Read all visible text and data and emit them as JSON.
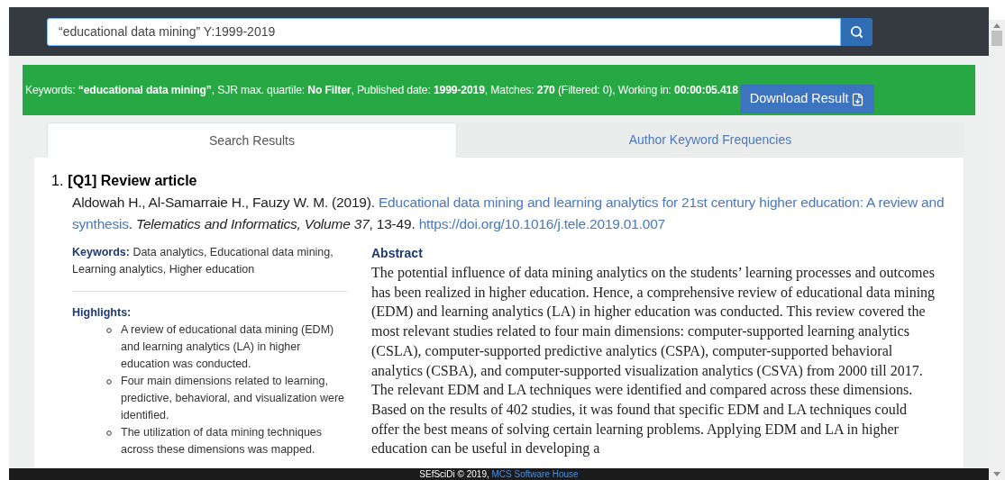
{
  "search": {
    "value": "“educational data mining” Y:1999-2019"
  },
  "banner": {
    "summary": "Keywords: **“educational data mining”**, SJR max. quartile: **No Filter**, Published date: **1999-2019**, Matches: **270** (Filtered: 0), Working in: **00:00:05.418**",
    "download_label": "Download Result"
  },
  "tabs": [
    {
      "label": "Search Results",
      "selected": true
    },
    {
      "label": "Author Keyword Frequencies",
      "selected": false
    }
  ],
  "results": [
    {
      "number": "1.",
      "title": "[Q1] Review article",
      "authors": "Aldowah H., Al-Samarraie H., Fauzy W. M. (2019). ",
      "article_title": "Educational data mining and learning analytics for 21st century higher education: A review and synthesis",
      "source": ". *Telematics and Informatics, Volume 37*, 13-49. ",
      "doi": "https://doi.org/10.1016/j.tele.2019.01.007",
      "keywords_label": "Keywords:",
      "keywords": "Data analytics, Educational data mining, Learning analytics, Higher education",
      "highlights_label": "Highlights:",
      "highlights": [
        "A review of educational data mining (EDM) and learning analytics (LA) in higher education was conducted.",
        "Four main dimensions related to learning, predictive, behavioral, and visualization were identified.",
        "The utilization of data mining techniques across these dimensions was mapped."
      ],
      "abstract_label": "Abstract",
      "abstract": "The potential influence of data mining analytics on the students’ learning processes and outcomes has been realized in higher education. Hence, a comprehensive review of educational data mining (EDM) and learning analytics (LA) in higher education was conducted. This review covered the most relevant studies related to four main dimensions: computer-supported learning analytics (CSLA), computer-supported predictive analytics (CSPA), computer-supported behavioral analytics (CSBA), and computer-supported visualization analytics (CSVA) from 2000 till 2017. The relevant EDM and LA techniques were identified and compared across these dimensions. Based on the results of 402 studies, it was found that specific EDM and LA techniques could offer the best means of solving certain learning problems. Applying EDM and LA in higher education can be useful in developing a"
    }
  ],
  "footer": {
    "text": "SEfSciDi © 2019, ",
    "link": "MCS Software House"
  }
}
